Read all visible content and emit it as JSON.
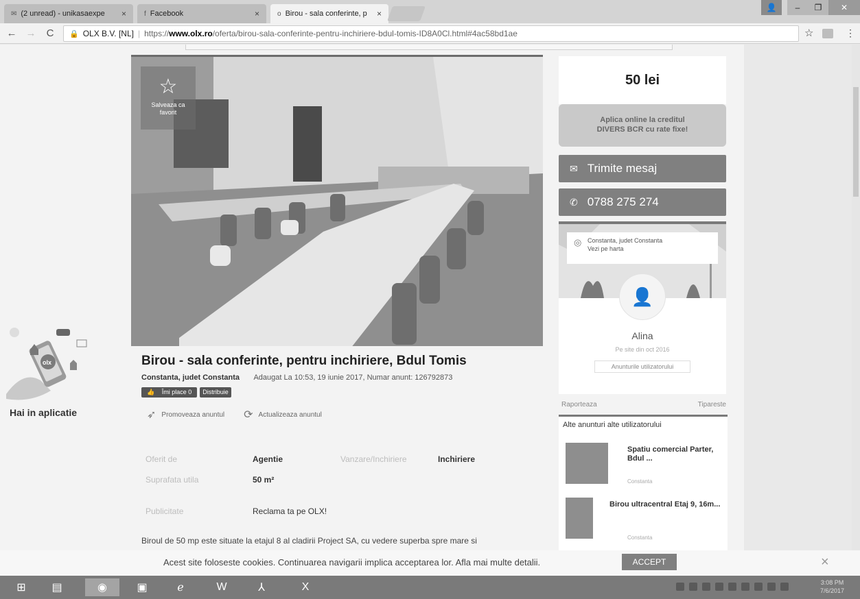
{
  "browser": {
    "tabs": [
      {
        "label": "(2 unread) - unikasaexpe",
        "icon": "mail-icon"
      },
      {
        "label": "Facebook",
        "icon": "facebook-icon"
      },
      {
        "label": "Birou - sala conferinte, p",
        "icon": "olx-icon"
      }
    ],
    "omnibox": {
      "site_identity": "OLX B.V. [NL]",
      "url_scheme": "https://",
      "url_host": "www.olx.ro",
      "url_path": "/oferta/birou-sala-conferinte-pentru-inchiriere-bdul-tomis-ID8A0Cl.html#4ac58bd1ae"
    }
  },
  "gallery": {
    "favorite_label": "Salveaza ca favorit"
  },
  "app_promo": {
    "title": "Hai in aplicatie"
  },
  "listing": {
    "title": "Birou - sala conferinte, pentru inchiriere, Bdul Tomis",
    "location": "Constanta, judet Constanta",
    "added_info": "Adaugat La 10:53, 19 iunie 2017, Numar anunt: 126792873",
    "like_label": "Îmi place 0",
    "share_label": "Distribuie",
    "promote_label": "Promoveaza anuntul",
    "refresh_label": "Actualizeaza anuntul",
    "details": [
      {
        "label": "Oferit de",
        "value": "Agentie"
      },
      {
        "label": "Vanzare/Inchiriere",
        "value": "Inchiriere"
      },
      {
        "label": "Suprafata utila",
        "value": "50 m²"
      },
      {
        "label": "Publicitate",
        "value": "Reclama ta pe OLX!"
      }
    ],
    "description": "Biroul de 50 mp este situate la etajul 8 al cladirii Project SA, cu vedere superba spre mare si"
  },
  "sidebar": {
    "price": "50 lei",
    "credit_line1": "Aplica online la creditul",
    "credit_line2": "DIVERS BCR cu rate fixe!",
    "message_button": "Trimite mesaj",
    "phone_button": "0788 275 274",
    "map_location": "Constanta, judet Constanta",
    "map_link": "Vezi pe harta",
    "user_name": "Alina",
    "user_since": "Pe site din oct 2016",
    "user_ads_link": "Anunturile utilizatorului",
    "report_link": "Raporteaza",
    "print_link": "Tipareste",
    "other_ads_title": "Alte anunturi alte utilizatorului",
    "other_ads": [
      {
        "title": "Spatiu comercial Parter, Bdul ...",
        "city": "Constanta"
      },
      {
        "title": "Birou ultracentral Etaj 9, 16m...",
        "city": "Constanta"
      }
    ]
  },
  "cookie": {
    "text": "Acest site foloseste cookies. Continuarea navigarii implica acceptarea lor. Afla mai multe detalii.",
    "accept": "ACCEPT"
  },
  "taskbar": {
    "time": "3:08 PM",
    "date": "7/6/2017"
  }
}
